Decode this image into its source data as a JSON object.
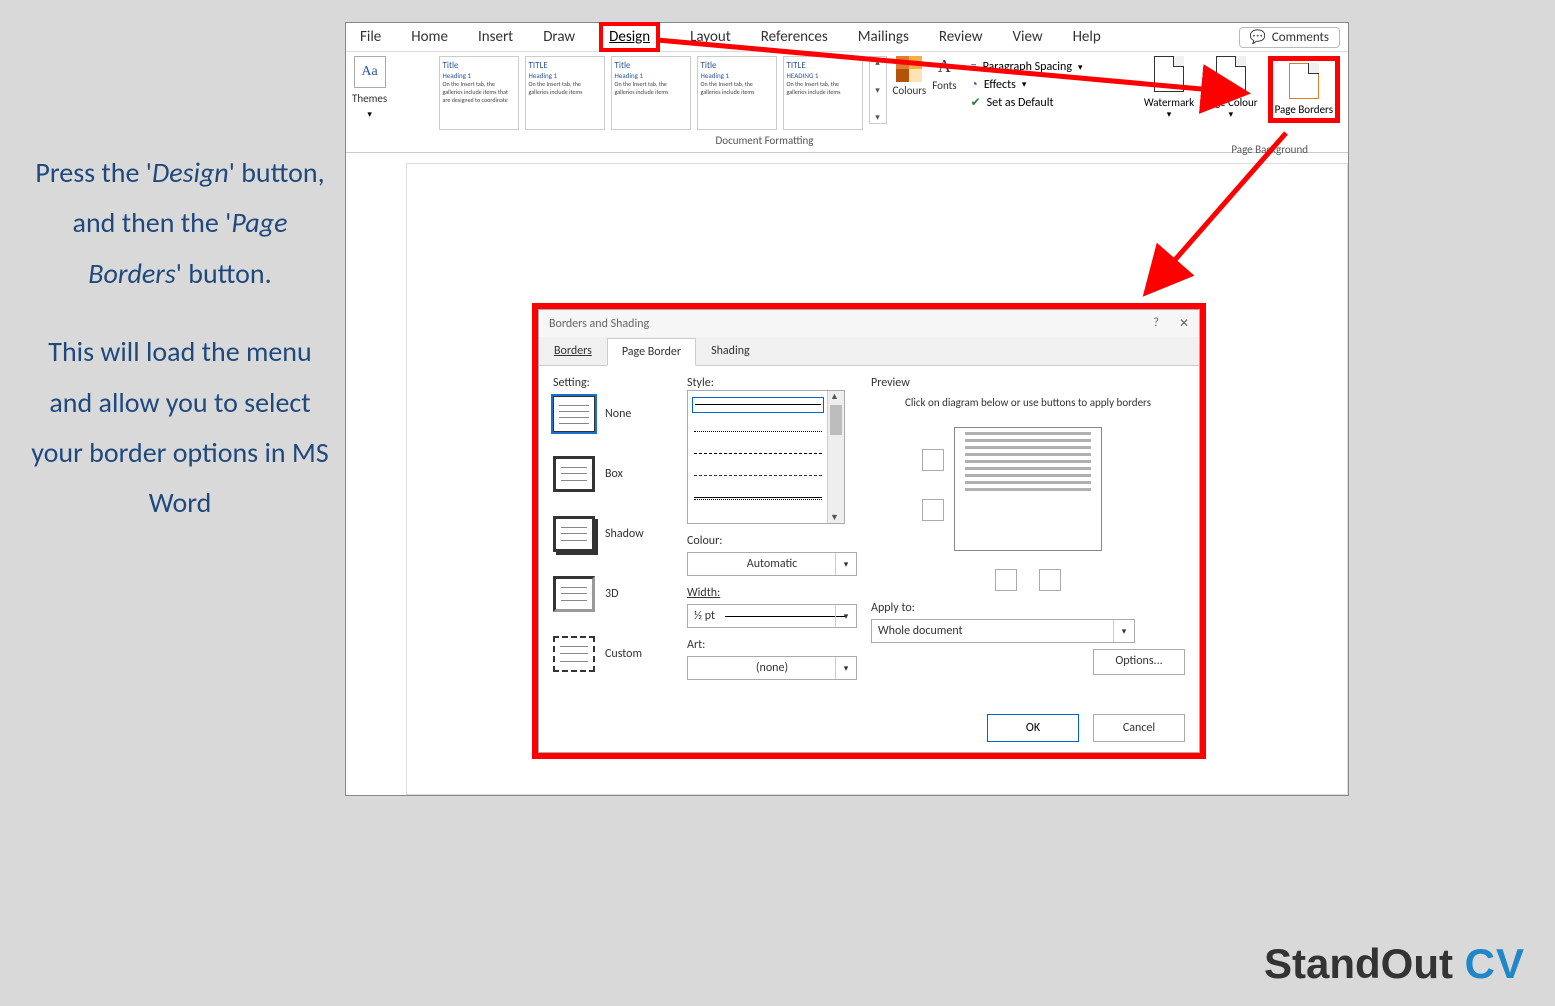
{
  "instruction": {
    "p1_a": "Press the '",
    "p1_design": "Design",
    "p1_b": "' button, and then the '",
    "p1_pb": "Page Borders",
    "p1_c": "' button.",
    "p2": "This will load the menu and allow you to select your border options in MS Word"
  },
  "tabs": [
    "File",
    "Home",
    "Insert",
    "Draw",
    "Design",
    "Layout",
    "References",
    "Mailings",
    "Review",
    "View",
    "Help"
  ],
  "comments": "Comments",
  "ribbon": {
    "themes": "Themes",
    "gallery": [
      {
        "title": "Title",
        "h": "Heading 1"
      },
      {
        "title": "TITLE",
        "h": "Heading 1"
      },
      {
        "title": "Title",
        "h": "Heading 1"
      },
      {
        "title": "Title",
        "h": "Heading 1"
      },
      {
        "title": "TITLE",
        "h": "HEADING 1"
      }
    ],
    "doc_fmt": "Document Formatting",
    "colours": "Colours",
    "fonts": "Fonts",
    "para": "Paragraph Spacing",
    "effects": "Effects",
    "setdefault": "Set as Default",
    "watermark": "Watermark",
    "page_colour": "Page Colour",
    "page_borders": "Page Borders",
    "page_bg": "Page Background"
  },
  "dialog": {
    "title": "Borders and Shading",
    "tabs": [
      "Borders",
      "Page Border",
      "Shading"
    ],
    "setting_label": "Setting:",
    "settings": [
      "None",
      "Box",
      "Shadow",
      "3D",
      "Custom"
    ],
    "style_label": "Style:",
    "colour_label": "Colour:",
    "colour_val": "Automatic",
    "width_label": "Width:",
    "width_val": "½ pt",
    "art_label": "Art:",
    "art_val": "(none)",
    "preview_label": "Preview",
    "preview_hint": "Click on diagram below or use buttons to apply borders",
    "apply_label": "Apply to:",
    "apply_val": "Whole document",
    "options": "Options...",
    "ok": "OK",
    "cancel": "Cancel"
  },
  "logo": {
    "a": "StandOut ",
    "b": "CV"
  }
}
